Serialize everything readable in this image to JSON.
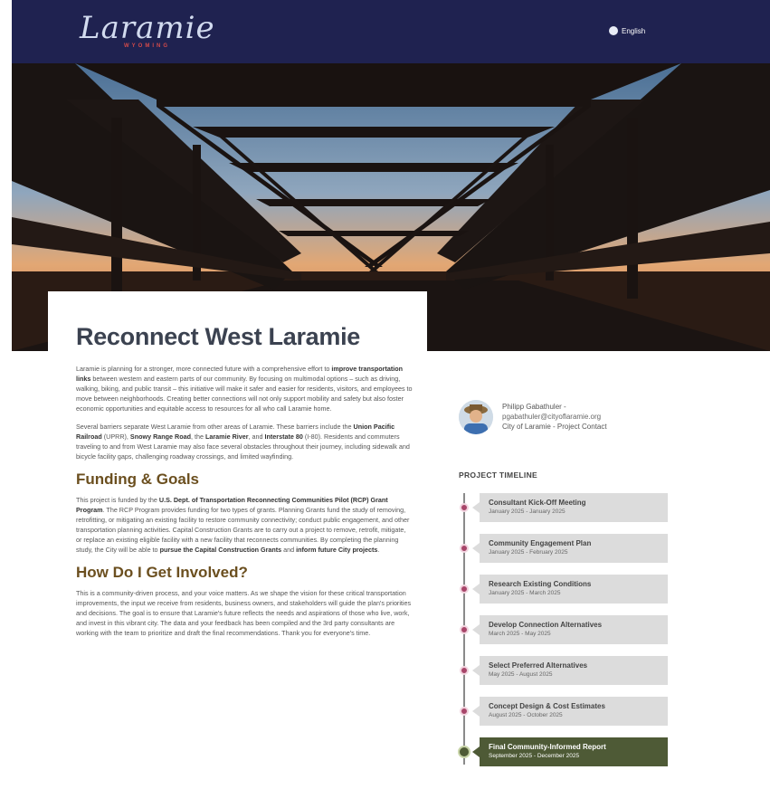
{
  "header": {
    "logo_text": "Laramie",
    "logo_sub": "WYOMING",
    "language": "English"
  },
  "page": {
    "title": "Reconnect West Laramie"
  },
  "intro": {
    "p1_a": "Laramie is planning for a stronger, more connected future with a comprehensive effort to ",
    "p1_b": "improve transportation links",
    "p1_c": " between western and eastern parts of our community. By focusing on multimodal options – such as driving, walking, biking, and public transit – this initiative will make it safer and easier for residents, visitors, and employees to move between neighborhoods. Creating better connections will not only support mobility and safety but also foster economic opportunities and equitable access to resources for all who call Laramie home.",
    "p2_a": "Several barriers separate West Laramie from other areas of Laramie. These barriers include the ",
    "p2_b": "Union Pacific Railroad",
    "p2_c": " (UPRR), ",
    "p2_d": "Snowy Range Road",
    "p2_e": ", the ",
    "p2_f": "Laramie River",
    "p2_g": ", and ",
    "p2_h": "Interstate 80",
    "p2_i": " (I-80). Residents and commuters traveling to and from West Laramie may also face several obstacles throughout their journey, including sidewalk and bicycle facility gaps, challenging roadway crossings, and limited wayfinding."
  },
  "funding": {
    "heading": "Funding & Goals",
    "p_a": "This project is funded by the ",
    "p_b": "U.S. Dept. of Transportation Reconnecting Communities Pilot (RCP) Grant Program",
    "p_c": ". The RCP Program provides funding for two types of grants. Planning Grants fund the study of removing, retrofitting, or mitigating an existing facility to restore community connectivity; conduct public engagement, and other transportation planning activities. Capital Construction Grants are to carry out a project to remove, retrofit, mitigate, or replace an existing eligible facility with a new facility that reconnects communities. By completing the planning study, the City will be able to ",
    "p_d": "pursue the Capital Construction Grants",
    "p_e": " and ",
    "p_f": "inform future City projects",
    "p_g": "."
  },
  "involved": {
    "heading": "How Do I Get Involved?",
    "p": "This is a community-driven process, and your voice matters. As we shape the vision for these critical transportation improvements, the input we receive from residents, business owners, and stakeholders will guide the plan's priorities and decisions. The goal is to ensure that Laramie's future reflects the needs and aspirations of those who live, work, and invest in this vibrant city. The data and your feedback has been compiled and the 3rd party consultants are working with the team to prioritize and draft the final recommendations. Thank you for everyone's time."
  },
  "contact": {
    "name": "Philipp Gabathuler -",
    "email": "pgabathuler@cityoflaramie.org",
    "role": "City of Laramie - Project Contact"
  },
  "timeline": {
    "title": "PROJECT TIMELINE",
    "items": [
      {
        "name": "Consultant Kick-Off Meeting",
        "date": "January 2025 - January 2025"
      },
      {
        "name": "Community Engagement Plan",
        "date": "January 2025 - February 2025"
      },
      {
        "name": "Research Existing Conditions",
        "date": "January 2025 - March 2025"
      },
      {
        "name": "Develop Connection Alternatives",
        "date": "March 2025 - May 2025"
      },
      {
        "name": "Select Preferred Alternatives",
        "date": "May 2025 - August 2025"
      },
      {
        "name": "Concept Design & Cost Estimates",
        "date": "August 2025 - October 2025"
      },
      {
        "name": "Final Community-Informed Report",
        "date": "September 2025 - December 2025"
      }
    ]
  },
  "colors": {
    "header_bg": "#1f2250",
    "heading_brown": "#6b4f1f",
    "timeline_dot": "#a8466a",
    "timeline_active": "#4e5a36"
  }
}
